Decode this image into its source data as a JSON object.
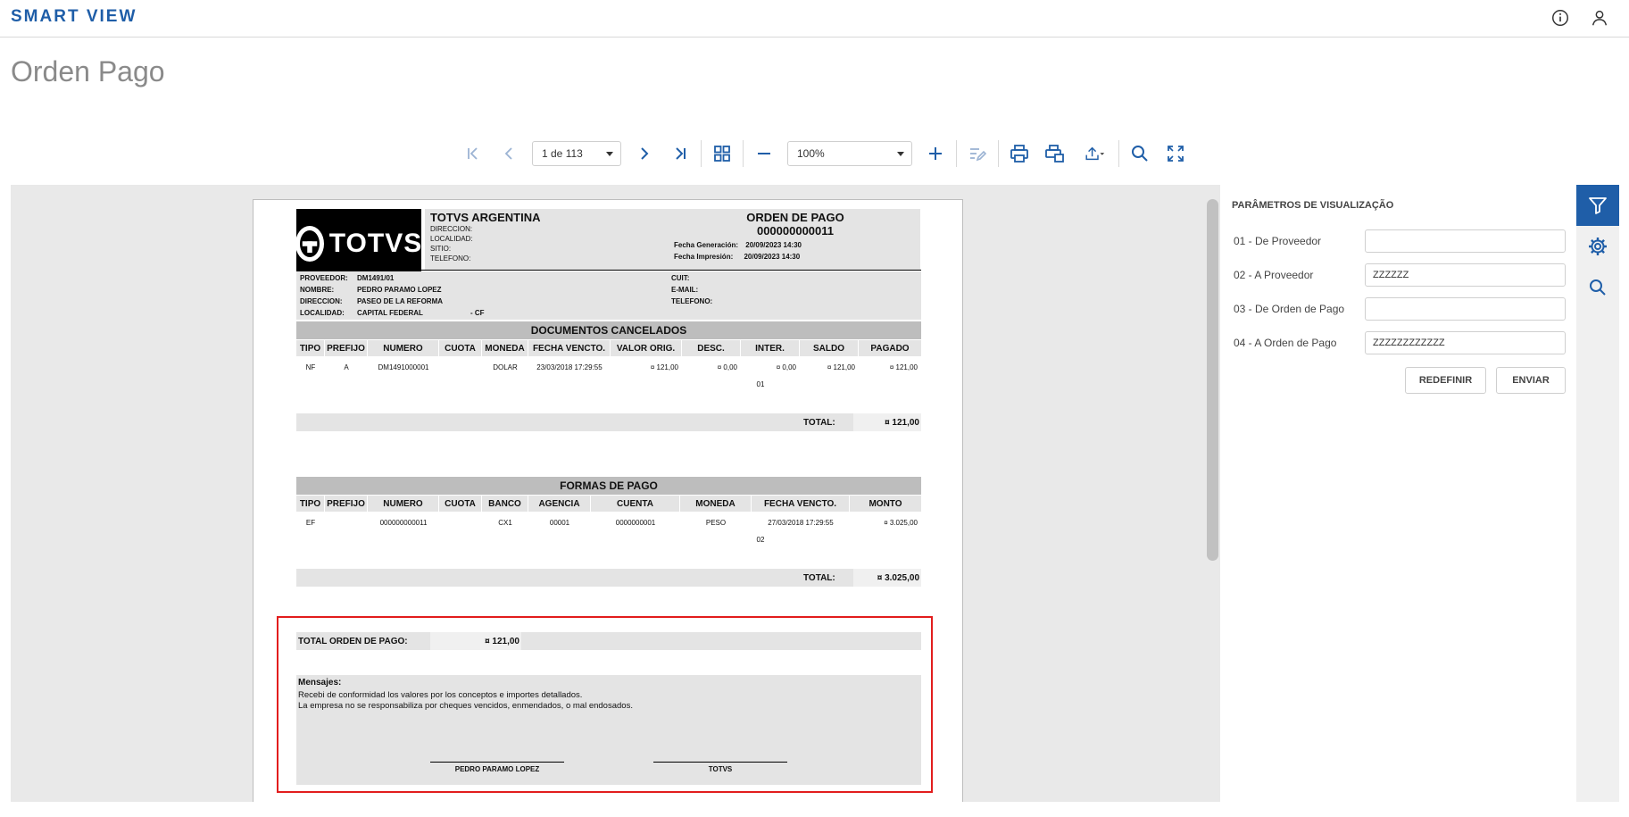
{
  "app": {
    "brand": "SMART VIEW",
    "page_title": "Orden Pago"
  },
  "toolbar": {
    "page_select": "1 de 113",
    "zoom_select": "100%"
  },
  "report": {
    "company": "TOTVS ARGENTINA",
    "logo_text": "TOTVS",
    "company_fields": [
      "DIRECCION:",
      "LOCALIDAD:",
      "SITIO:",
      "TELEFONO:"
    ],
    "doc_title": "ORDEN DE PAGO",
    "doc_number": "000000000011",
    "fecha_generacion_label": "Fecha Generación:",
    "fecha_generacion": "20/09/2023 14:30",
    "fecha_impresion_label": "Fecha Impresión:",
    "fecha_impresion": "20/09/2023 14:30",
    "supplier": {
      "proveedor_label": "PROVEEDOR:",
      "proveedor": "DM1491/01",
      "nombre_label": "NOMBRE:",
      "nombre": "PEDRO PARAMO LOPEZ",
      "direccion_label": "DIRECCION:",
      "direccion": "PASEO DE LA REFORMA",
      "localidad_label": "LOCALIDAD:",
      "localidad": "CAPITAL FEDERAL",
      "cf": "- CF",
      "cuit_label": "CUIT:",
      "email_label": "E-MAIL:",
      "telefono_label": "TELEFONO:"
    },
    "docs": {
      "title": "DOCUMENTOS CANCELADOS",
      "headers": [
        "TIPO",
        "PREFIJO",
        "NUMERO",
        "CUOTA",
        "MONEDA",
        "FECHA VENCTO.",
        "VALOR ORIG.",
        "DESC.",
        "INTER.",
        "SALDO",
        "PAGADO"
      ],
      "row": [
        "NF",
        "A",
        "DM1491000001",
        "",
        "DOLAR",
        "23/03/2018 17:29:55",
        "¤ 121,00",
        "¤ 0,00",
        "¤ 0,00",
        "¤ 121,00",
        "¤ 121,00"
      ],
      "sub": "01",
      "total_label": "TOTAL:",
      "total": "¤ 121,00"
    },
    "formas": {
      "title": "FORMAS DE PAGO",
      "headers": [
        "TIPO",
        "PREFIJO",
        "NUMERO",
        "CUOTA",
        "BANCO",
        "AGENCIA",
        "CUENTA",
        "MONEDA",
        "FECHA VENCTO.",
        "MONTO"
      ],
      "row": [
        "EF",
        "",
        "000000000011",
        "",
        "CX1",
        "00001",
        "0000000001",
        "PESO",
        "27/03/2018 17:29:55",
        "¤ 3.025,00"
      ],
      "sub": "02",
      "total_label": "TOTAL:",
      "total": "¤ 3.025,00"
    },
    "total_orden_label": "TOTAL ORDEN DE PAGO:",
    "total_orden": "¤ 121,00",
    "mensajes_label": "Mensajes:",
    "mensaje_1": "Recebi de conformidad los valores por los conceptos e importes detallados.",
    "mensaje_2": "La empresa no se responsabiliza por cheques vencidos, enmendados, o mal endosados.",
    "firma_1": "PEDRO PARAMO LOPEZ",
    "firma_2": "TOTVS"
  },
  "params": {
    "title": "PARÂMETROS DE VISUALIZAÇÃO",
    "fields": [
      {
        "label": "01 - De Proveedor",
        "value": ""
      },
      {
        "label": "02 - A Proveedor",
        "value": "ZZZZZZ"
      },
      {
        "label": "03 - De Orden de Pago",
        "value": ""
      },
      {
        "label": "04 - A Orden de Pago",
        "value": "ZZZZZZZZZZZZ"
      }
    ],
    "reset_label": "REDEFINIR",
    "send_label": "ENVIAR"
  },
  "colors": {
    "brand": "#1f5ea8",
    "highlight_box": "#e21d1d"
  }
}
